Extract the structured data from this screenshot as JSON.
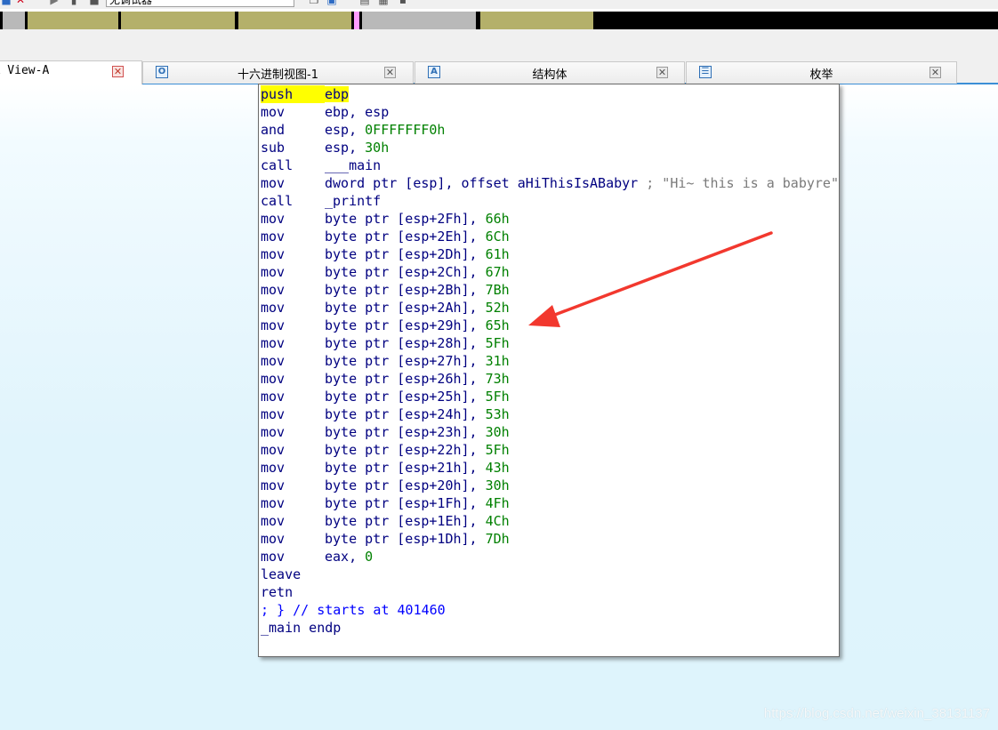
{
  "toolbar": {
    "debugger_select_value": "无调试器"
  },
  "nav_band": {
    "colors": {
      "olive": "#b4b06a",
      "gray": "#b9b9b9",
      "pink": "#ff9cff",
      "black": "#000000"
    }
  },
  "tabs": [
    {
      "label": "IDA View-A",
      "active": true,
      "icon": "graph-view-icon"
    },
    {
      "label": "十六进制视图-1",
      "active": false,
      "icon": "hex-view-icon"
    },
    {
      "label": "结构体",
      "active": false,
      "icon": "structures-icon"
    },
    {
      "label": "枚举",
      "active": false,
      "icon": "enums-icon"
    }
  ],
  "disasm": [
    {
      "mn": "push",
      "ops": "ebp"
    },
    {
      "mn": "mov",
      "ops": "ebp, esp"
    },
    {
      "mn": "and",
      "ops": "esp, ",
      "imm": "0FFFFFFF0h"
    },
    {
      "mn": "sub",
      "ops": "esp, ",
      "imm": "30h"
    },
    {
      "mn": "call",
      "ops": "___main"
    },
    {
      "mn": "mov",
      "ops": "dword ptr [esp], offset aHiThisIsABabyr",
      "comment": " ; \"Hi~ this is a babyre\""
    },
    {
      "mn": "call",
      "ops": "_printf"
    },
    {
      "mn": "mov",
      "ops": "byte ptr [esp+2Fh], ",
      "imm": "66h"
    },
    {
      "mn": "mov",
      "ops": "byte ptr [esp+2Eh], ",
      "imm": "6Ch"
    },
    {
      "mn": "mov",
      "ops": "byte ptr [esp+2Dh], ",
      "imm": "61h"
    },
    {
      "mn": "mov",
      "ops": "byte ptr [esp+2Ch], ",
      "imm": "67h"
    },
    {
      "mn": "mov",
      "ops": "byte ptr [esp+2Bh], ",
      "imm": "7Bh"
    },
    {
      "mn": "mov",
      "ops": "byte ptr [esp+2Ah], ",
      "imm": "52h"
    },
    {
      "mn": "mov",
      "ops": "byte ptr [esp+29h], ",
      "imm": "65h"
    },
    {
      "mn": "mov",
      "ops": "byte ptr [esp+28h], ",
      "imm": "5Fh"
    },
    {
      "mn": "mov",
      "ops": "byte ptr [esp+27h], ",
      "imm": "31h"
    },
    {
      "mn": "mov",
      "ops": "byte ptr [esp+26h], ",
      "imm": "73h"
    },
    {
      "mn": "mov",
      "ops": "byte ptr [esp+25h], ",
      "imm": "5Fh"
    },
    {
      "mn": "mov",
      "ops": "byte ptr [esp+24h], ",
      "imm": "53h"
    },
    {
      "mn": "mov",
      "ops": "byte ptr [esp+23h], ",
      "imm": "30h"
    },
    {
      "mn": "mov",
      "ops": "byte ptr [esp+22h], ",
      "imm": "5Fh"
    },
    {
      "mn": "mov",
      "ops": "byte ptr [esp+21h], ",
      "imm": "43h"
    },
    {
      "mn": "mov",
      "ops": "byte ptr [esp+20h], ",
      "imm": "30h"
    },
    {
      "mn": "mov",
      "ops": "byte ptr [esp+1Fh], ",
      "imm": "4Fh"
    },
    {
      "mn": "mov",
      "ops": "byte ptr [esp+1Eh], ",
      "imm": "4Ch"
    },
    {
      "mn": "mov",
      "ops": "byte ptr [esp+1Dh], ",
      "imm": "7Dh"
    },
    {
      "mn": "mov",
      "ops": "eax, ",
      "imm": "0"
    },
    {
      "mn": "leave",
      "ops": ""
    },
    {
      "mn": "retn",
      "ops": ""
    }
  ],
  "footer_comment": "; } // starts at 401460",
  "endp_line": "_main endp",
  "watermark": "https://blog.csdn.net/weixin_38131137",
  "colors": {
    "annotation_arrow": "#f2382e",
    "highlight": "#ffff00"
  }
}
